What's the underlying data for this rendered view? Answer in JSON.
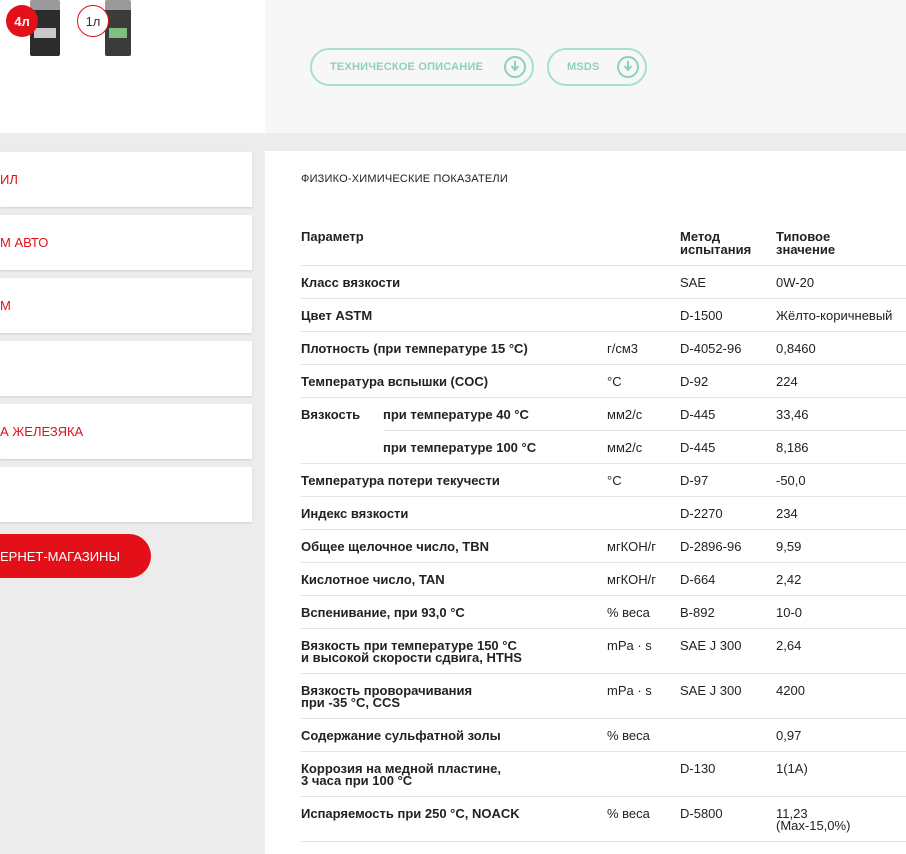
{
  "product": {
    "volumes": [
      {
        "label": "4л",
        "active": true
      },
      {
        "label": "1л",
        "active": false
      }
    ]
  },
  "downloads": {
    "tech_label": "ТЕХНИЧЕСКОЕ ОПИСАНИЕ",
    "msds_label": "MSDS",
    "icon": "download-icon",
    "accent_color": "#8fd0bd"
  },
  "nav": {
    "items": [
      "ИЛ",
      "М АВТО",
      "М",
      "",
      "А ЖЕЛЕЗЯКА",
      ""
    ],
    "shops_label": "ЕРНЕТ-МАГАЗИНЫ",
    "accent_color": "#e3101a"
  },
  "specs": {
    "title": "ФИЗИКО-ХИМИЧЕСКИЕ ПОКАЗАТЕЛИ",
    "headers": {
      "param": "Параметр",
      "method_line1": "Метод",
      "method_line2": "испытания",
      "value_line1": "Типовое",
      "value_line2": "значение"
    },
    "rows": [
      {
        "param": "Класс вязкости",
        "unit": "",
        "method": "SAE",
        "value": "0W-20"
      },
      {
        "param": "Цвет ASTM",
        "unit": "",
        "method": "D-1500",
        "value": "Жёлто-коричневый"
      },
      {
        "param": "Плотность (при температуре 15 °С)",
        "unit": "г/см3",
        "method": "D-4052-96",
        "value": "0,8460"
      },
      {
        "param": "Температура вспышки (COC)",
        "unit": "°С",
        "method": "D-92",
        "value": "224"
      },
      {
        "param": "Вязкость",
        "sub": "при температуре 40 °С",
        "unit": "мм2/с",
        "method": "D-445",
        "value": "33,46"
      },
      {
        "param": "",
        "sub": "при температуре 100 °С",
        "unit": "мм2/с",
        "method": "D-445",
        "value": "8,186"
      },
      {
        "param": "Температура потери текучести",
        "unit": "°С",
        "method": "D-97",
        "value": "-50,0"
      },
      {
        "param": "Индекс вязкости",
        "unit": "",
        "method": "D-2270",
        "value": "234"
      },
      {
        "param": "Общее щелочное число, TBN",
        "unit": "мгКОН/г",
        "method": "D-2896-96",
        "value": "9,59"
      },
      {
        "param": "Кислотное число, TAN",
        "unit": "мгКОН/г",
        "method": "D-664",
        "value": "2,42"
      },
      {
        "param": "Вспенивание, при 93,0 °С",
        "unit": "% веса",
        "method": "B-892",
        "value": "10-0"
      },
      {
        "param": "Вязкость при температуре 150 °С",
        "param2": "и высокой скорости сдвига, HTHS",
        "unit": "mPa · s",
        "method": "SAE J 300",
        "value": "2,64"
      },
      {
        "param": "Вязкость проворачивания",
        "param2": "при -35 °С, CCS",
        "unit": "mPa · s",
        "method": "SAE J 300",
        "value": "4200"
      },
      {
        "param": "Содержание сульфатной золы",
        "unit": "% веса",
        "method": "",
        "value": "0,97"
      },
      {
        "param": "Коррозия на медной пластине,",
        "param2": "3 часа при 100 °С",
        "unit": "",
        "method": "D-130",
        "value": "1(1А)"
      },
      {
        "param": "Испаряемость при 250 °С, NOACK",
        "unit": "% веса",
        "method": "D-5800",
        "value": "11,23",
        "value2": "(Max-15,0%)"
      }
    ]
  }
}
